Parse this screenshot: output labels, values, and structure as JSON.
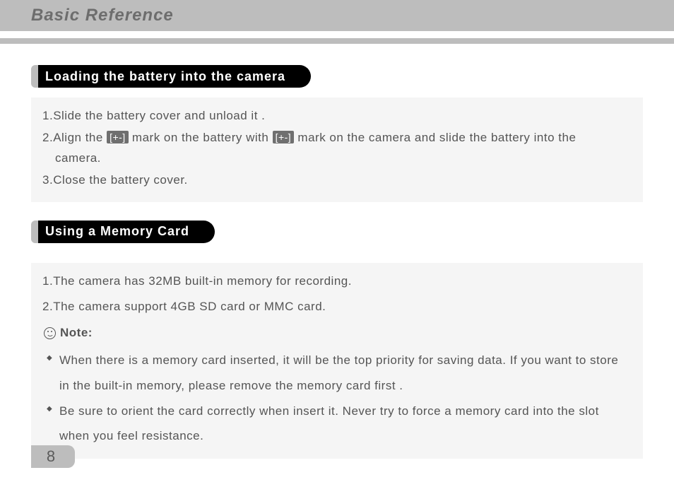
{
  "header": {
    "title": "Basic Reference"
  },
  "sections": {
    "battery": {
      "heading": "Loading  the  battery  into  the  camera",
      "steps": {
        "s1_num": "1.",
        "s1_text": "Slide the battery cover and unload it .",
        "s2_num": "2.",
        "s2_a": "Align the ",
        "s2_badge1": "[+-]",
        "s2_b": " mark on the battery with ",
        "s2_badge2": "[+-]",
        "s2_c": " mark on the camera and slide the battery into the",
        "s2_cont": "camera.",
        "s3_num": "3.",
        "s3_text": "Close the battery cover."
      }
    },
    "memory": {
      "heading": "Using  a  Memory  Card",
      "steps": {
        "s1_num": "1.",
        "s1_text": "The camera has 32MB built-in memory for recording.",
        "s2_num": "2.",
        "s2_text": "The camera support 4GB SD card or MMC card."
      },
      "note_label": "Note:",
      "bullets": {
        "b1": "When there is a memory card inserted, it will be the top priority for saving data. If you want to store in the built-in memory, please remove the memory card first .",
        "b2": "Be sure to orient the card correctly when insert it. Never try to force a memory card into the slot when you feel resistance."
      }
    }
  },
  "page_number": "8"
}
